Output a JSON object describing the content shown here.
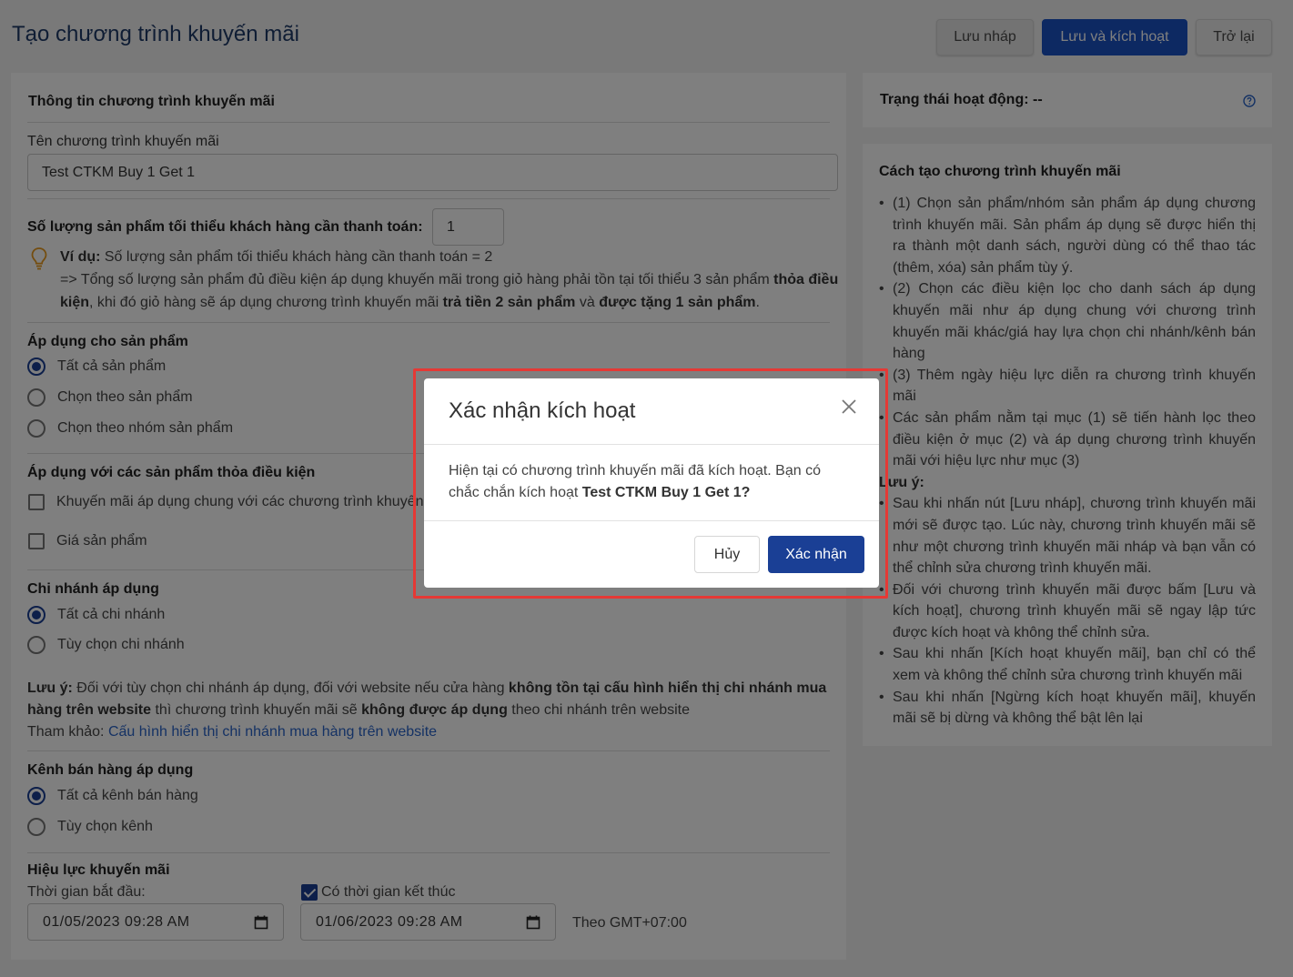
{
  "header": {
    "title": "Tạo chương trình khuyến mãi",
    "draft_label": "Lưu nháp",
    "activate_label": "Lưu và kích hoạt",
    "back_label": "Trở lại"
  },
  "info": {
    "section_title": "Thông tin chương trình khuyến mãi",
    "name_label": "Tên chương trình khuyến mãi",
    "name_value": "Test CTKM Buy 1 Get 1",
    "min_qty_label": "Số lượng sản phẩm tối thiểu khách hàng cần thanh toán:",
    "min_qty_value": "1",
    "example_prefix": "Ví dụ:",
    "example_line1": " Số lượng sản phẩm tối thiểu khách hàng cần thanh toán = 2",
    "example_line2a": "=> Tổng số lượng sản phẩm đủ điều kiện áp dụng khuyến mãi trong giỏ hàng phải tồn tại tối thiểu 3 sản phẩm ",
    "example_bold1": "thỏa điều kiện",
    "example_line2b": ", khi đó giỏ hàng sẽ áp dụng chương trình khuyến mãi ",
    "example_bold2": "trả tiền 2 sản phẩm",
    "example_line2c": " và ",
    "example_bold3": "được tặng 1 sản phẩm",
    "example_end": "."
  },
  "apply_products": {
    "title": "Áp dụng cho sản phẩm",
    "options": [
      "Tất cả sản phẩm",
      "Chọn theo sản phẩm",
      "Chọn theo nhóm sản phẩm"
    ],
    "selected": 0
  },
  "conditions": {
    "title": "Áp dụng với các sản phẩm thỏa điều kiện",
    "opt1": "Khuyến mãi áp dụng chung với các chương trình khuyến mãi khác",
    "opt2": "Giá sản phẩm"
  },
  "branches": {
    "title": "Chi nhánh áp dụng",
    "options": [
      "Tất cả chi nhánh",
      "Tùy chọn chi nhánh"
    ],
    "selected": 0
  },
  "branch_note": {
    "head": "Lưu ý:",
    "t1": " Đối với tùy chọn chi nhánh áp dụng, đối với website nếu cửa hàng ",
    "b1": "không tồn tại cấu hình hiển thị chi nhánh mua hàng trên website",
    "t2": " thì chương trình khuyến mãi sẽ ",
    "b2": "không được áp dụng",
    "t3": " theo chi nhánh trên website",
    "ref_label": "Tham khảo: ",
    "ref_link": "Cấu hình hiển thị chi nhánh mua hàng trên website"
  },
  "channels": {
    "title": "Kênh bán hàng áp dụng",
    "options": [
      "Tất cả kênh bán hàng",
      "Tùy chọn kênh"
    ],
    "selected": 0
  },
  "validity": {
    "title": "Hiệu lực khuyến mãi",
    "start_label": "Thời gian bắt đầu:",
    "end_label": "Có thời gian kết thúc",
    "start_value": "01/05/2023 09:28 AM",
    "end_value": "01/06/2023 09:28 AM",
    "timezone": "Theo GMT+07:00"
  },
  "status": {
    "text": "Trạng thái hoạt động: --"
  },
  "guide": {
    "title": "Cách tạo chương trình khuyến mãi",
    "steps": [
      "(1) Chọn sản phẩm/nhóm sản phẩm áp dụng chương trình khuyến mãi. Sản phẩm áp dụng sẽ được hiển thị ra thành một danh sách, người dùng có thể thao tác (thêm, xóa) sản phẩm tùy ý.",
      "(2) Chọn các điều kiện lọc cho danh sách áp dụng khuyến mãi như áp dụng chung với chương trình khuyến mãi khác/giá hay lựa chọn chi nhánh/kênh bán hàng",
      "(3) Thêm ngày hiệu lực diễn ra chương trình khuyến mãi",
      "Các sản phẩm nằm tại mục (1) sẽ tiến hành lọc theo điều kiện ở mục (2) và áp dụng chương trình khuyến mãi với hiệu lực như mục (3)"
    ],
    "note_title": "Lưu ý:",
    "notes": [
      "Sau khi nhấn nút [Lưu nháp], chương trình khuyến mãi mới sẽ được tạo. Lúc này, chương trình khuyến mãi sẽ như một chương trình khuyến mãi nháp và bạn vẫn có thể chỉnh sửa chương trình khuyến mãi.",
      "Đối với chương trình khuyến mãi được bấm [Lưu và kích hoạt], chương trình khuyến mãi sẽ ngay lập tức được kích hoạt và không thể chỉnh sửa.",
      "Sau khi nhấn [Kích hoạt khuyến mãi], bạn chỉ có thể xem và không thể chỉnh sửa chương trình khuyến mãi",
      "Sau khi nhấn [Ngừng kích hoạt khuyến mãi], khuyến mãi sẽ bị dừng và không thể bật lên lại"
    ]
  },
  "modal": {
    "title": "Xác nhận kích hoạt",
    "body_prefix": "Hiện tại có chương trình khuyến mãi đã kích hoạt. Bạn có chắc chắn kích hoạt ",
    "body_bold": "Test CTKM Buy 1 Get 1?",
    "cancel_label": "Hủy",
    "confirm_label": "Xác nhận"
  },
  "colors": {
    "primary": "#1a3f95",
    "activate_button": "#1a52c4",
    "title": "#1f3a68",
    "link": "#2b64c9",
    "highlight": "#e53935"
  }
}
